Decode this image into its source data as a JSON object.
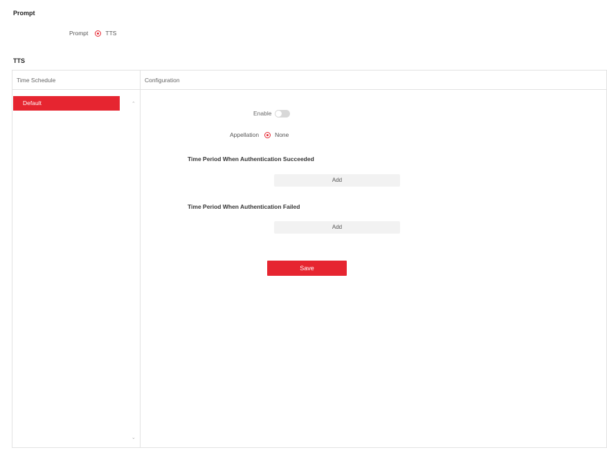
{
  "prompt": {
    "section_title": "Prompt",
    "label": "Prompt",
    "option": "TTS"
  },
  "tts": {
    "section_title": "TTS",
    "time_schedule_header": "Time Schedule",
    "configuration_header": "Configuration",
    "schedule_items": [
      "Default"
    ],
    "enable_label": "Enable",
    "enable_state": "off",
    "appellation_label": "Appellation",
    "appellation_option": "None",
    "success_title": "Time Period When Authentication Succeeded",
    "success_add": "Add",
    "failed_title": "Time Period When Authentication Failed",
    "failed_add": "Add",
    "save_label": "Save"
  },
  "colors": {
    "accent": "#e62530",
    "border": "#e2e2e2",
    "button_bg": "#f2f2f2"
  }
}
